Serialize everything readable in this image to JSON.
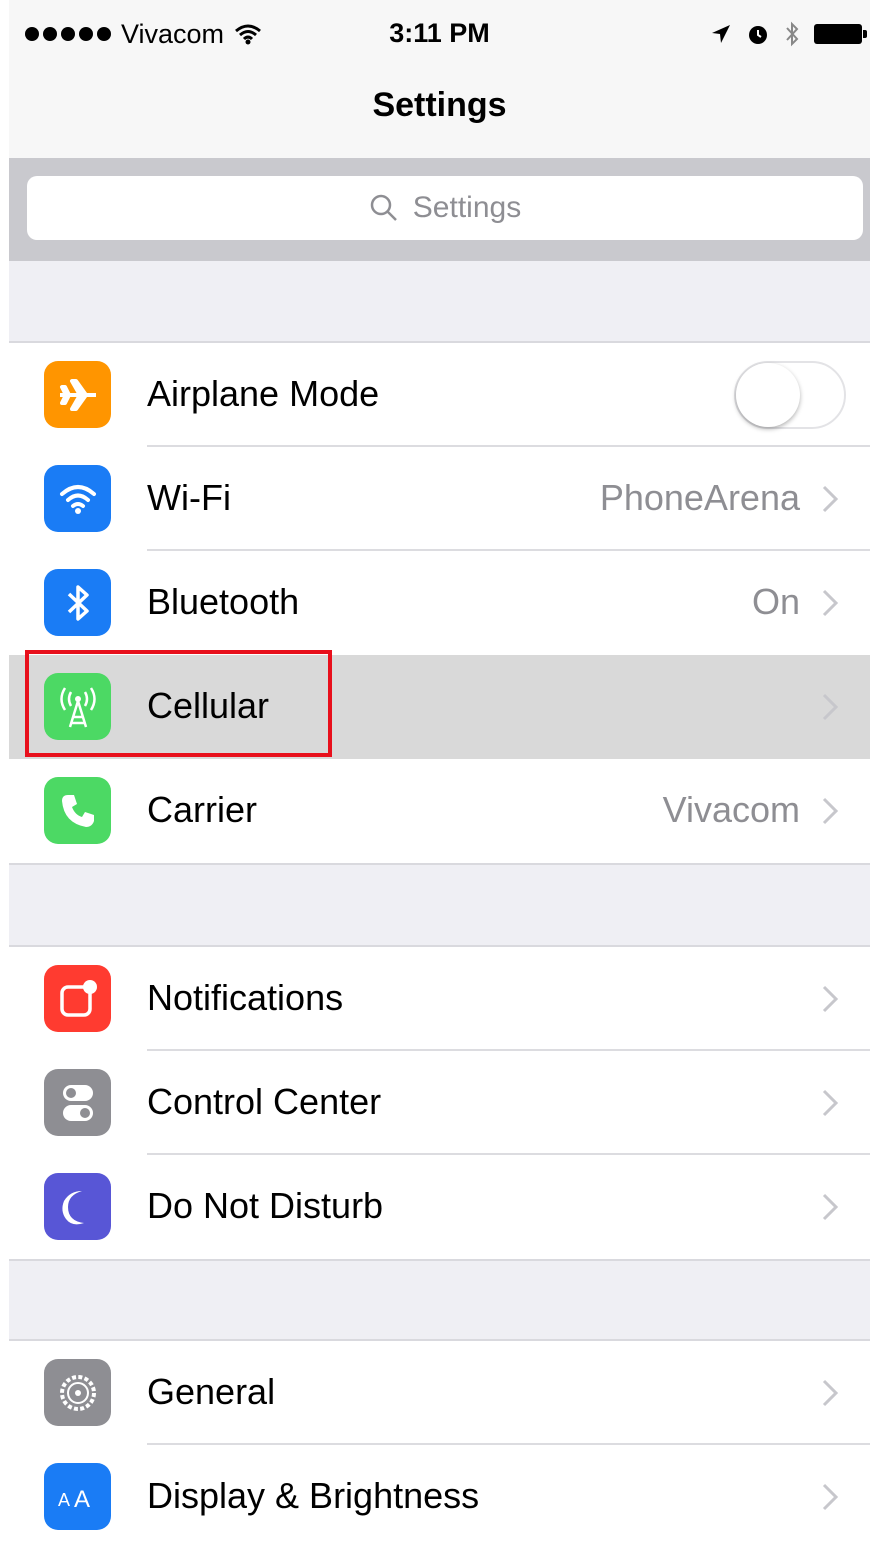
{
  "status_bar": {
    "carrier": "Vivacom",
    "time": "3:11 PM",
    "signal_bars": 5
  },
  "nav": {
    "title": "Settings"
  },
  "search": {
    "placeholder": "Settings"
  },
  "groups": [
    {
      "rows": [
        {
          "label": "Airplane Mode",
          "icon": "airplane-icon",
          "icon_color": "#ff9500",
          "control": "toggle",
          "toggle_on": false
        },
        {
          "label": "Wi-Fi",
          "icon": "wifi-icon",
          "icon_color": "#1a7cf5",
          "value": "PhoneArena"
        },
        {
          "label": "Bluetooth",
          "icon": "bluetooth-icon",
          "icon_color": "#1a7cf5",
          "value": "On"
        },
        {
          "label": "Cellular",
          "icon": "cellular-icon",
          "icon_color": "#4cd964",
          "highlighted": true
        },
        {
          "label": "Carrier",
          "icon": "phone-icon",
          "icon_color": "#4cd964",
          "value": "Vivacom"
        }
      ]
    },
    {
      "rows": [
        {
          "label": "Notifications",
          "icon": "notifications-icon",
          "icon_color": "#ff3b30"
        },
        {
          "label": "Control Center",
          "icon": "control-center-icon",
          "icon_color": "#8e8e93"
        },
        {
          "label": "Do Not Disturb",
          "icon": "moon-icon",
          "icon_color": "#5856d6"
        }
      ]
    },
    {
      "rows": [
        {
          "label": "General",
          "icon": "gear-icon",
          "icon_color": "#8e8e93"
        },
        {
          "label": "Display & Brightness",
          "icon": "display-icon",
          "icon_color": "#1a7cf5"
        }
      ]
    }
  ],
  "colors": {
    "highlight_box": "#e8101c",
    "value_text": "#8e8e93",
    "background": "#efeff4"
  }
}
